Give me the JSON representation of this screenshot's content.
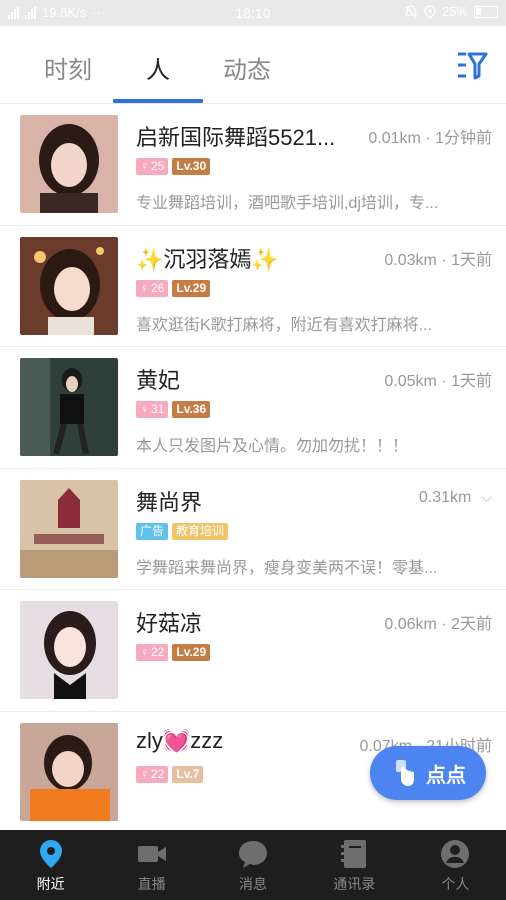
{
  "status_bar": {
    "network_speed": "19.8K/s",
    "dots": "···",
    "time": "18:10",
    "battery": "25%"
  },
  "tabs": [
    {
      "label": "时刻",
      "active": false
    },
    {
      "label": "人",
      "active": true
    },
    {
      "label": "动态",
      "active": false
    }
  ],
  "list": [
    {
      "name": "启新国际舞蹈5521...",
      "meta": "0.01km · 1分钟前",
      "badge1": "25",
      "level": "Lv.30",
      "desc": "专业舞蹈培训，酒吧歌手培训,dj培训，专..."
    },
    {
      "name": "✨沉羽落嫣✨",
      "meta": "0.03km · 1天前",
      "badge1": "26",
      "level": "Lv.29",
      "desc": "喜欢逛街K歌打麻将，附近有喜欢打麻将..."
    },
    {
      "name": "黄妃",
      "meta": "0.05km · 1天前",
      "badge1": "31",
      "level": "Lv.36",
      "desc": "本人只发图片及心情。勿加勿扰！！！"
    },
    {
      "name": "舞尚界",
      "meta": "0.31km",
      "ad_label": "广告",
      "category": "教育培训",
      "desc": "学舞蹈来舞尚界，瘦身变美两不误！零基..."
    },
    {
      "name": "好菇凉",
      "meta": "0.06km · 2天前",
      "badge1": "22",
      "level": "Lv.29",
      "desc": ""
    },
    {
      "name": "zly💓zzz",
      "meta": "0.07km · 21小时前",
      "badge1": "22",
      "level": "Lv.7",
      "desc": ""
    }
  ],
  "fab": {
    "label": "点点"
  },
  "bottom_nav": [
    {
      "label": "附近",
      "icon": "location-pin-icon",
      "active": true
    },
    {
      "label": "直播",
      "icon": "video-camera-icon",
      "active": false
    },
    {
      "label": "消息",
      "icon": "chat-bubble-icon",
      "active": false
    },
    {
      "label": "通讯录",
      "icon": "address-book-icon",
      "active": false
    },
    {
      "label": "个人",
      "icon": "person-icon",
      "active": false
    }
  ],
  "colors": {
    "accent": "#2b73d6",
    "fab": "#4c84f0",
    "nav_bg": "#1e1e1e"
  }
}
